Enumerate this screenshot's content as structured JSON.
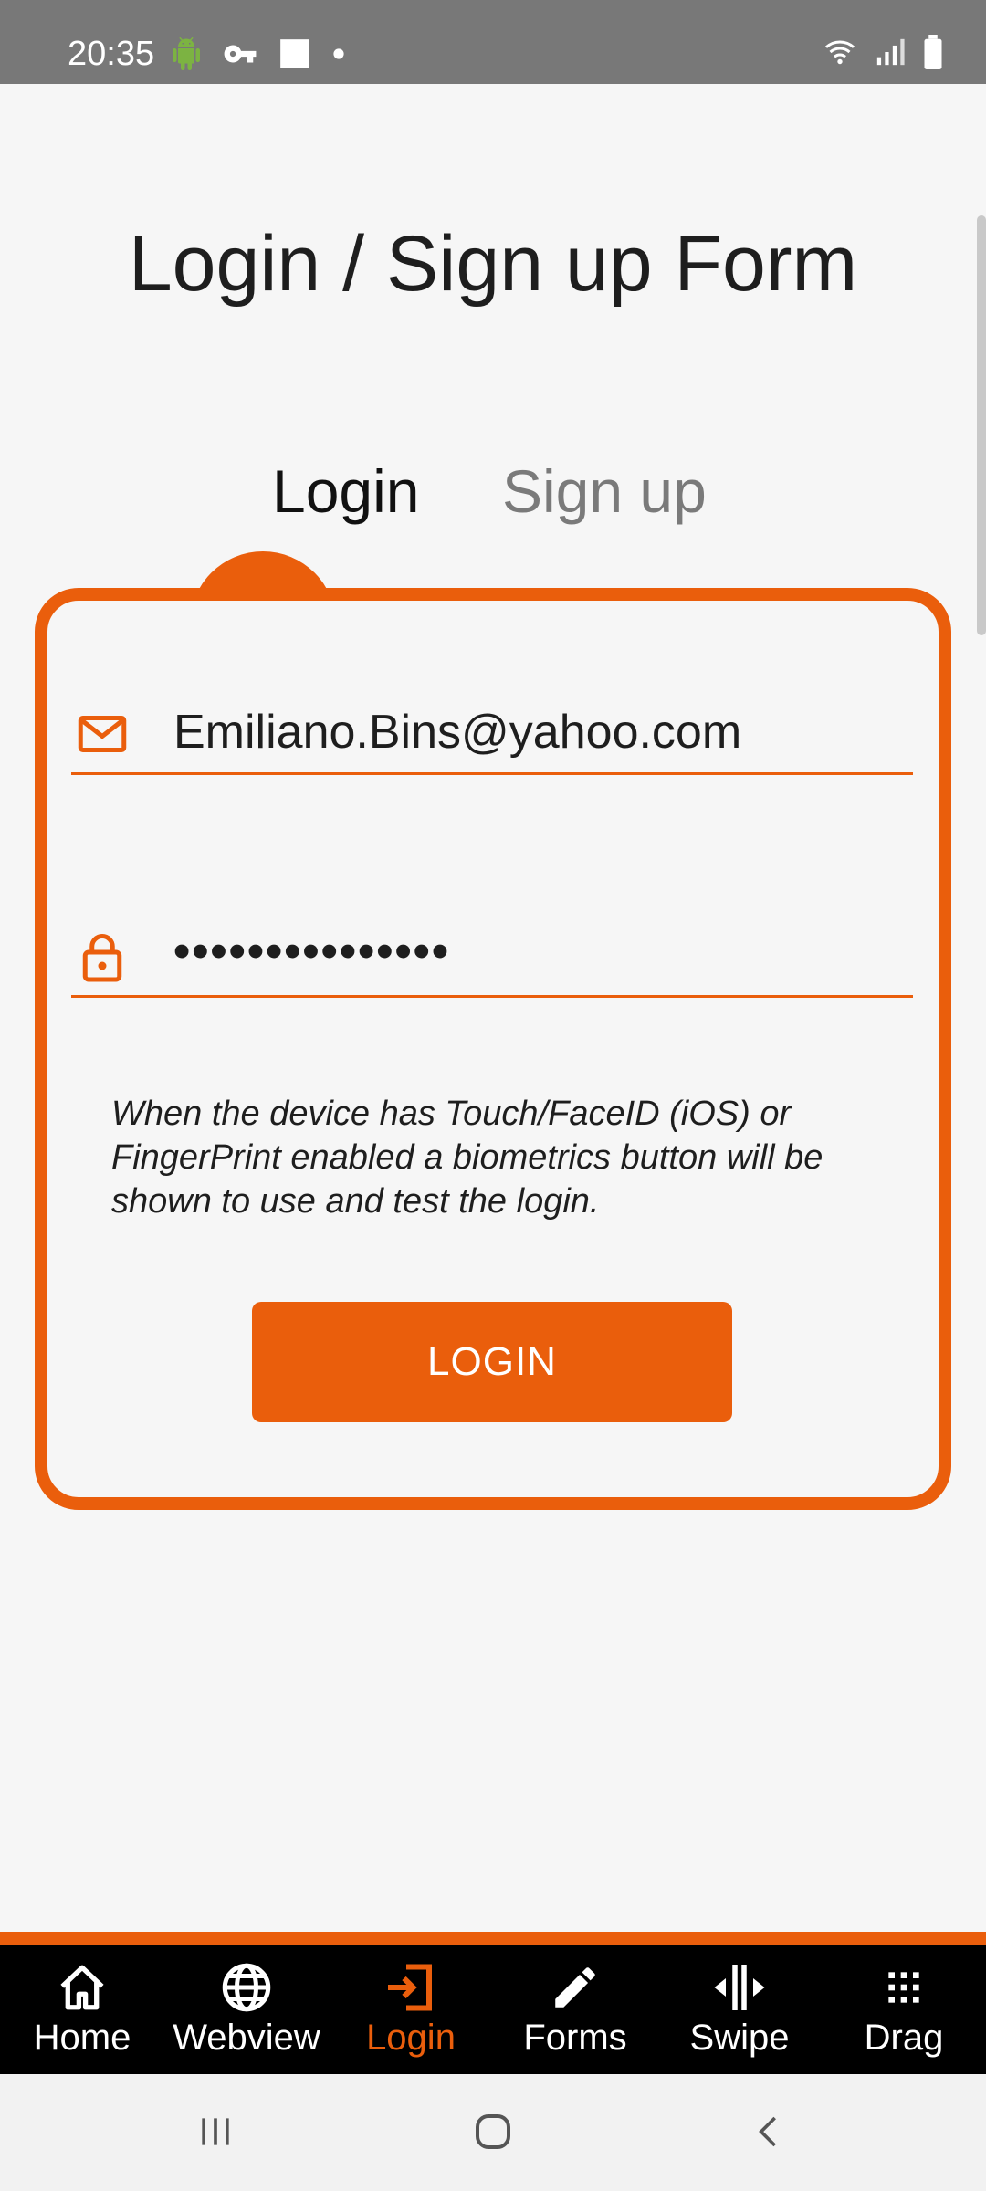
{
  "status_bar": {
    "time": "20:35",
    "left_icons": [
      "android-icon",
      "key-icon",
      "square-notification-icon",
      "dot-icon"
    ],
    "right_icons": [
      "wifi-icon",
      "signal-icon",
      "battery-icon"
    ]
  },
  "page": {
    "title": "Login / Sign up Form"
  },
  "tabs": {
    "login": "Login",
    "signup": "Sign up",
    "active": "login"
  },
  "form": {
    "email": {
      "value": "Emiliano.Bins@yahoo.com",
      "icon": "mail-icon"
    },
    "password": {
      "value": "•••••••••••••••",
      "icon": "lock-icon"
    },
    "info": "When the device has Touch/FaceID (iOS) or FingerPrint enabled a biometrics button will be shown to use and test the login.",
    "submit_label": "LOGIN"
  },
  "tabbar": {
    "items": [
      {
        "label": "Home",
        "icon": "home-icon"
      },
      {
        "label": "Webview",
        "icon": "globe-icon"
      },
      {
        "label": "Login",
        "icon": "login-icon",
        "active": true
      },
      {
        "label": "Forms",
        "icon": "pencil-icon"
      },
      {
        "label": "Swipe",
        "icon": "swipe-icon"
      },
      {
        "label": "Drag",
        "icon": "grid-icon"
      }
    ]
  },
  "colors": {
    "accent": "#ea5e0c",
    "background": "#f6f6f6",
    "status_bar": "#787878",
    "tabbar": "#000000"
  },
  "nav_bar": {
    "buttons": [
      "recents-icon",
      "home-circle-icon",
      "back-icon"
    ]
  }
}
